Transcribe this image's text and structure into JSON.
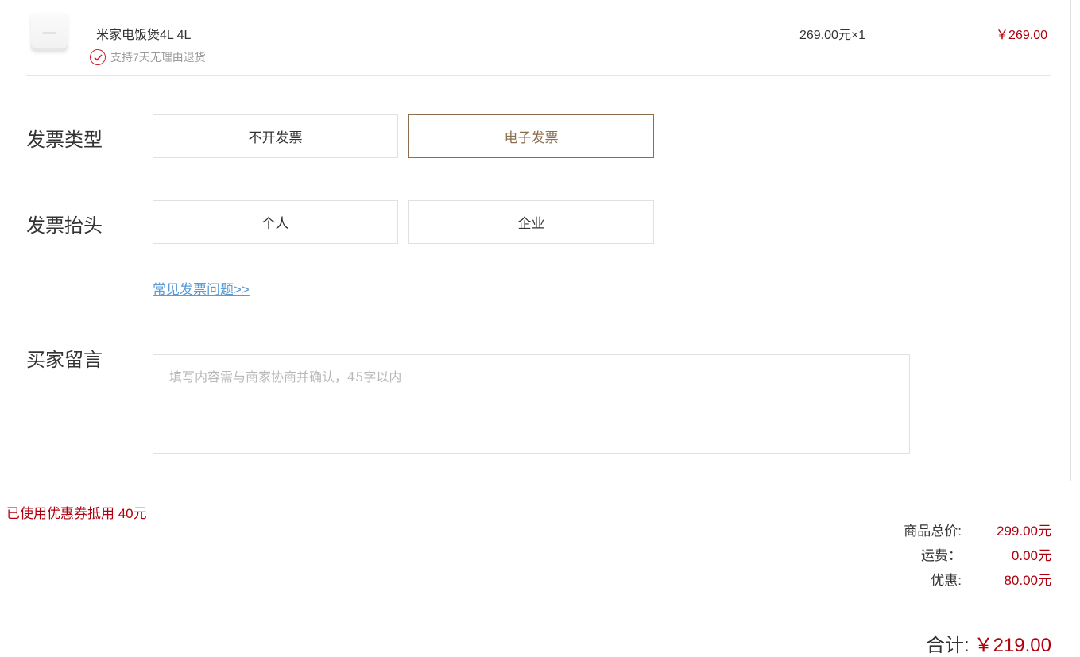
{
  "product": {
    "image_icon": "rice-cooker-thumbnail",
    "name": "米家电饭煲4L 4L",
    "return_policy": "支持7天无理由退货",
    "unit_price_qty": "269.00元×1",
    "line_total": "￥269.00"
  },
  "invoice_type": {
    "label": "发票类型",
    "options": [
      "不开发票",
      "电子发票"
    ],
    "selected": "电子发票"
  },
  "invoice_title": {
    "label": "发票抬头",
    "options": [
      "个人",
      "企业"
    ]
  },
  "faq_link": "常见发票问题>>",
  "message": {
    "label": "买家留言",
    "placeholder": "填写内容需与商家协商并确认，45字以内",
    "value": ""
  },
  "coupon_note": "已使用优惠券抵用 40元",
  "summary": {
    "goods_total_label": "商品总价:",
    "goods_total_value": "299.00元",
    "shipping_label": "运费：",
    "shipping_value": "0.00元",
    "discount_label": "优惠:",
    "discount_value": "80.00元",
    "grand_total_label": "合计:",
    "grand_total_value": "￥219.00"
  },
  "colors": {
    "price_red": "#b0000e",
    "selected_brown": "#8c6d4f",
    "link_blue": "#5b9bd5",
    "check_red": "#d01f2a"
  }
}
